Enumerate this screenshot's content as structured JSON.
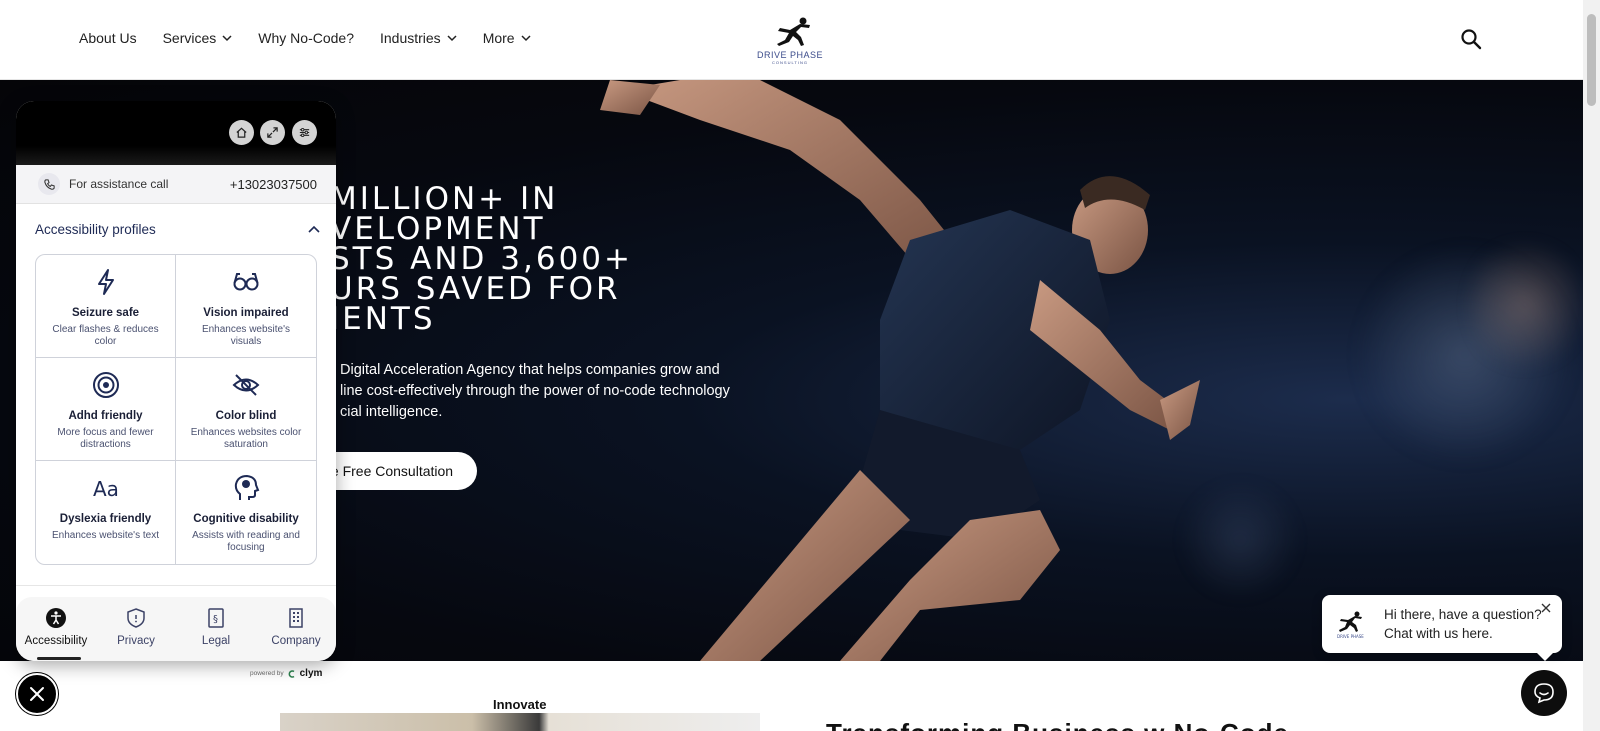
{
  "nav": {
    "items": [
      {
        "label": "About Us",
        "dropdown": false
      },
      {
        "label": "Services",
        "dropdown": true
      },
      {
        "label": "Why No-Code?",
        "dropdown": false
      },
      {
        "label": "Industries",
        "dropdown": true
      },
      {
        "label": "More",
        "dropdown": true
      }
    ],
    "logo_text": "DRIVE PHASE",
    "logo_sub": "CONSULTING",
    "search_icon": "search-icon"
  },
  "hero": {
    "title_lines": [
      "MILLION+ IN",
      "VELOPMENT",
      "STS AND 3,600+",
      "URS SAVED FOR",
      "IENTS"
    ],
    "description_lines": [
      "Digital Acceleration Agency that helps companies grow and",
      "line cost-effectively through the power of no-code technology",
      "cial intelligence."
    ],
    "cta_label": "ule Free Consultation"
  },
  "below": {
    "innovate_label": "Innovate",
    "heading": "Transforming Business w No-Code"
  },
  "accessibility": {
    "assist_label": "For assistance call",
    "assist_number": "+13023037500",
    "profiles_title": "Accessibility profiles",
    "profiles": [
      {
        "title": "Seizure safe",
        "desc": "Clear flashes & reduces color",
        "icon": "bolt-icon"
      },
      {
        "title": "Vision impaired",
        "desc": "Enhances website's visuals",
        "icon": "glasses-icon"
      },
      {
        "title": "Adhd friendly",
        "desc": "More focus and fewer distractions",
        "icon": "target-icon"
      },
      {
        "title": "Color blind",
        "desc": "Enhances websites color saturation",
        "icon": "eye-slash-icon"
      },
      {
        "title": "Dyslexia friendly",
        "desc": "Enhances website's text",
        "icon": "text-icon"
      },
      {
        "title": "Cognitive disability",
        "desc": "Assists with reading and focusing",
        "icon": "head-brain-icon"
      }
    ],
    "tabs": [
      {
        "label": "Accessibility",
        "icon": "accessibility-icon",
        "active": true
      },
      {
        "label": "Privacy",
        "icon": "shield-icon",
        "active": false
      },
      {
        "label": "Legal",
        "icon": "section-doc-icon",
        "active": false
      },
      {
        "label": "Company",
        "icon": "building-icon",
        "active": false
      }
    ],
    "powered_by": "powered by",
    "powered_brand": "clym"
  },
  "chat": {
    "line1": "Hi there, have a question?",
    "line2": "Chat with us here."
  },
  "colors": {
    "accent_dark": "#1e2a55",
    "hero_bg": "#06080f"
  }
}
